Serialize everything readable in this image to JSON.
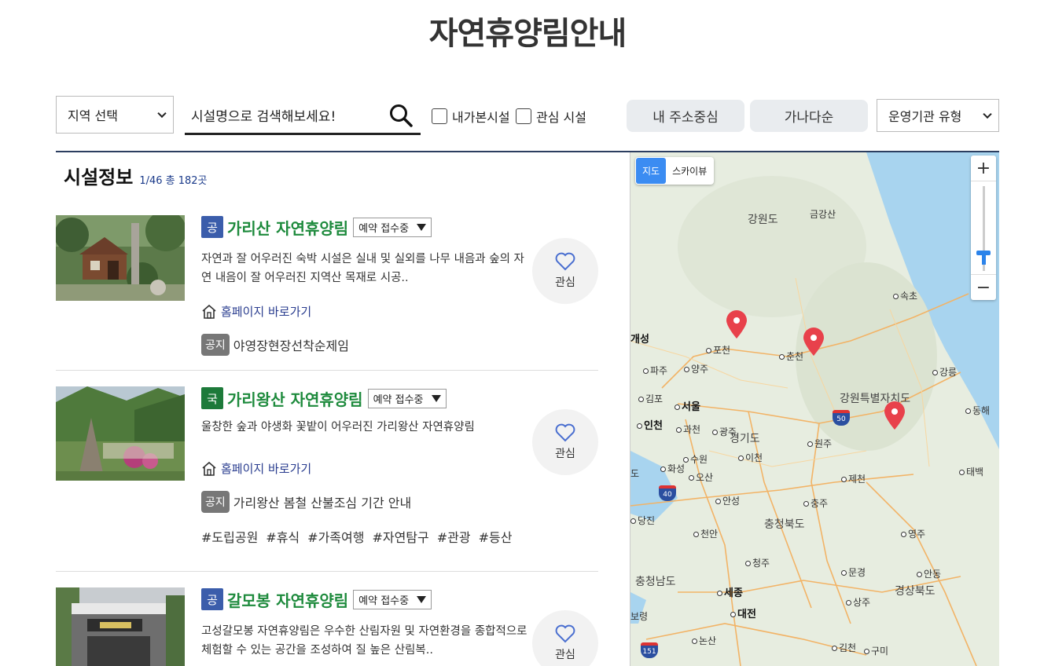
{
  "page": {
    "title": "자연휴양림안내"
  },
  "toolbar": {
    "region_select": "지역 선택",
    "search_placeholder": "시설명으로 검색해보세요!",
    "check_visited": "내가본시설",
    "check_favorite": "관심 시설",
    "sort_address": "내 주소중심",
    "sort_name": "가나다순",
    "org_type_select": "운영기관 유형"
  },
  "list": {
    "heading": "시설정보",
    "count": "1/46 총 182곳",
    "cards": [
      {
        "type": "공",
        "name": "가리산 자연휴양림",
        "status": "예약 접수중",
        "desc": " 자연과 잘 어우러진 숙박 시설은 실내 및 실외를 나무 내음과 숲의 자연 내음이 잘 어우러진 지역산 목재로 시공..",
        "home": "홈페이지 바로가기",
        "notice_badge": "공지",
        "notice": "야영장현장선착순제임",
        "fav": "관심"
      },
      {
        "type": "국",
        "name": "가리왕산 자연휴양림",
        "status": "예약 접수중",
        "desc": "울창한 숲과 야생화 꽃밭이 어우러진 가리왕산 자연휴양림",
        "home": "홈페이지 바로가기",
        "notice_badge": "공지",
        "notice": "가리왕산 봄철 산불조심 기간 안내",
        "tags": [
          "#도립공원",
          "#휴식",
          "#가족여행",
          "#자연탐구",
          "#관광",
          "#등산"
        ],
        "fav": "관심"
      },
      {
        "type": "공",
        "name": "갈모봉 자연휴양림",
        "status": "예약 접수중",
        "desc": "고성갈모봉 자연휴양림은 우수한 산림자원 및 자연환경을 종합적으로 체험할 수 있는 공간을 조성하여 질 높은 산림복..",
        "fav": "관심"
      }
    ]
  },
  "map": {
    "type_map": "지도",
    "type_sky": "스카이뷰",
    "zoom_in": "+",
    "zoom_out": "−",
    "labels": {
      "gangwon": "강원도",
      "geumgang": "금강산",
      "sokcho": "속초",
      "gaeseong": "개성",
      "pocheon": "포천",
      "chuncheon": "춘천",
      "paju": "파주",
      "yangju": "양주",
      "gangneung": "강릉",
      "gimpo": "김포",
      "seoul": "서울",
      "gangwon_sp": "강원특별자치도",
      "donghae": "동해",
      "incheon": "인천",
      "gwacheon": "과천",
      "gwangju": "광주",
      "gyeonggi": "경기도",
      "suwon": "수원",
      "icheon": "이천",
      "wonju": "원주",
      "hwaseong": "화성",
      "osan": "오산",
      "jecheon": "제천",
      "taebaek": "태백",
      "do_edge": "도",
      "anseong": "안성",
      "chungju": "충주",
      "dangjin": "당진",
      "chungbuk": "충청북도",
      "cheonan": "천안",
      "yeongju": "영주",
      "cheongju": "청주",
      "mungyeong": "문경",
      "andong": "안동",
      "chungnam": "충청남도",
      "sejong": "세종",
      "gyeongbuk": "경상북도",
      "sangju": "상주",
      "daejeon": "대전",
      "boryeong": "보령",
      "nonsan": "논산",
      "gimcheon": "김천",
      "gumi": "구미"
    },
    "routes": [
      "50",
      "40",
      "151"
    ],
    "water_color": "#a8d4ef",
    "pin_color": "#e8414b"
  }
}
